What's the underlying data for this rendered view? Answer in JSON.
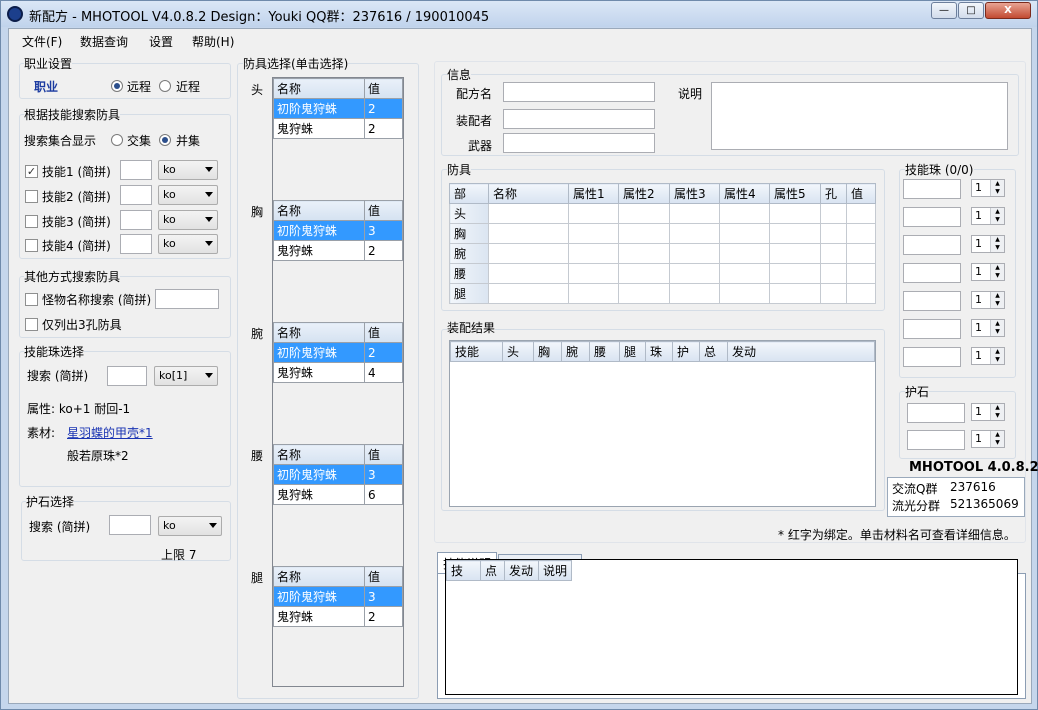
{
  "window": {
    "title": "新配方 - MHOTOOL V4.0.8.2   Design：Youki   QQ群：237616 / 190010045",
    "minimize": "—",
    "maximize": "□",
    "close": "X"
  },
  "menu": [
    "文件(F)",
    "数据查询",
    "设置",
    "帮助(H)"
  ],
  "profession": {
    "legend": "职业设置",
    "label": "职业",
    "option_ranged": "远程",
    "option_melee": "近程",
    "selected": "远程"
  },
  "skill_search": {
    "legend": "根据技能搜索防具",
    "mode_label": "搜索集合显示",
    "mode_intersect": "交集",
    "mode_union": "并集",
    "selected": "并集",
    "skills": [
      {
        "label": "技能1 (简拼)",
        "checked": true,
        "value": "",
        "combo": "ko"
      },
      {
        "label": "技能2 (简拼)",
        "checked": false,
        "value": "",
        "combo": "ko"
      },
      {
        "label": "技能3 (简拼)",
        "checked": false,
        "value": "",
        "combo": "ko"
      },
      {
        "label": "技能4 (简拼)",
        "checked": false,
        "value": "",
        "combo": "ko"
      }
    ]
  },
  "other_search": {
    "legend": "其他方式搜索防具",
    "monster_label": "怪物名称搜索 (简拼)",
    "monster_value": "",
    "three_slot_label": "仅列出3孔防具"
  },
  "jewel_select": {
    "legend": "技能珠选择",
    "search_label": "搜索 (简拼)",
    "search_value": "",
    "combo": "ko[1]",
    "attr_label": "属性: ko+1 耐回-1",
    "material_label": "素材:",
    "material_1": "星羽蝶的甲壳*1",
    "material_2": "般若原珠*2"
  },
  "charm_select": {
    "legend": "护石选择",
    "search_label": "搜索 (简拼)",
    "search_value": "",
    "combo": "ko",
    "limit_label": "上限 7"
  },
  "armor_select": {
    "legend": "防具选择(单击选择)",
    "name_header": "名称",
    "value_header": "值",
    "parts": [
      {
        "part": "头",
        "rows": [
          {
            "name": "初阶鬼狩蛛",
            "val": "2",
            "sel": true
          },
          {
            "name": "鬼狩蛛",
            "val": "2",
            "sel": false
          }
        ]
      },
      {
        "part": "胸",
        "rows": [
          {
            "name": "初阶鬼狩蛛",
            "val": "3",
            "sel": true
          },
          {
            "name": "鬼狩蛛",
            "val": "2",
            "sel": false
          }
        ]
      },
      {
        "part": "腕",
        "rows": [
          {
            "name": "初阶鬼狩蛛",
            "val": "2",
            "sel": true
          },
          {
            "name": "鬼狩蛛",
            "val": "4",
            "sel": false
          }
        ]
      },
      {
        "part": "腰",
        "rows": [
          {
            "name": "初阶鬼狩蛛",
            "val": "3",
            "sel": true
          },
          {
            "name": "鬼狩蛛",
            "val": "6",
            "sel": false
          }
        ]
      },
      {
        "part": "腿",
        "rows": [
          {
            "name": "初阶鬼狩蛛",
            "val": "3",
            "sel": true
          },
          {
            "name": "鬼狩蛛",
            "val": "2",
            "sel": false
          }
        ]
      }
    ]
  },
  "info": {
    "legend": "信息",
    "recipe_label": "配方名",
    "recipe_value": "",
    "author_label": "装配者",
    "author_value": "",
    "weapon_label": "武器",
    "weapon_value": "",
    "desc_label": "说明",
    "desc_value": ""
  },
  "armor": {
    "legend": "防具",
    "headers": [
      "部",
      "名称",
      "属性1",
      "属性2",
      "属性3",
      "属性4",
      "属性5",
      "孔",
      "值"
    ],
    "rows": [
      "头",
      "胸",
      "腕",
      "腰",
      "腿"
    ]
  },
  "jewels": {
    "legend": "技能珠 (0/0)",
    "count": "1"
  },
  "charm": {
    "legend": "护石",
    "count": "1"
  },
  "result": {
    "legend": "装配结果",
    "headers": [
      "技能",
      "头",
      "胸",
      "腕",
      "腰",
      "腿",
      "珠",
      "护",
      "总",
      "发动"
    ]
  },
  "brand": {
    "name": "MHOTOOL 4.0.8.2",
    "qq_label": "交流Q群",
    "qq_value": "237616",
    "stream_label": "流光分群",
    "stream_value": "521365069"
  },
  "bottom": {
    "tab_skill": "技能说明",
    "tab_material": "防具锻造材料",
    "note": "* 红字为绑定。单击材料名可查看详细信息。",
    "headers": [
      "技",
      "点",
      "发动",
      "说明"
    ]
  }
}
